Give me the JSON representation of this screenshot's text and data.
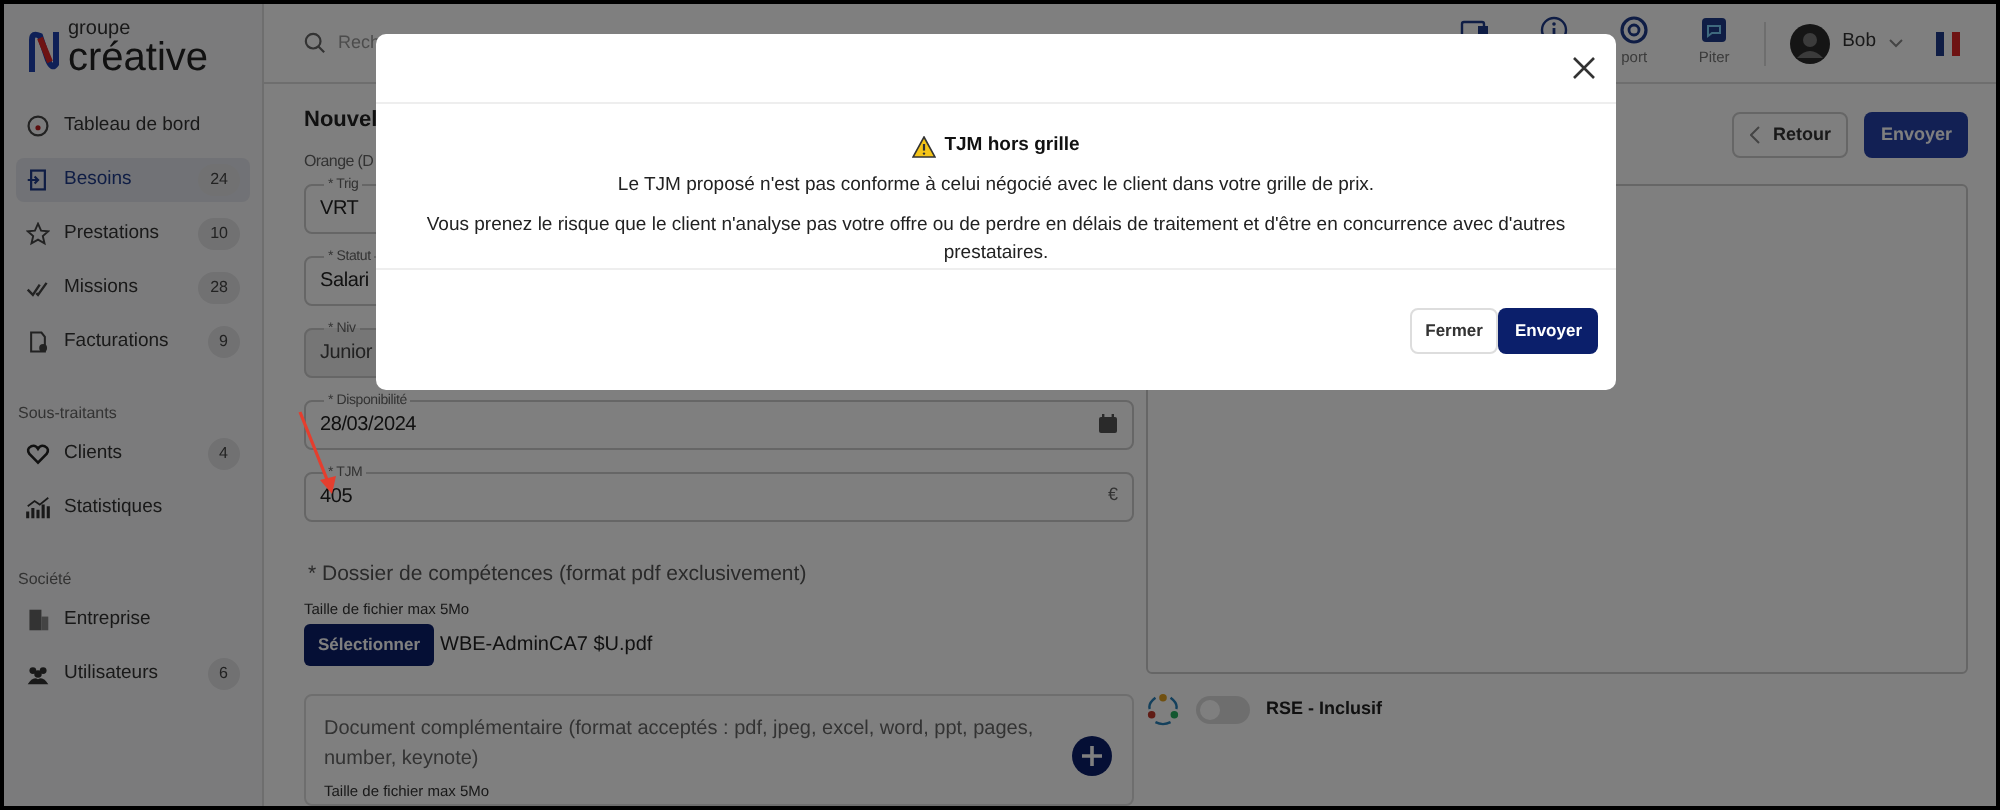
{
  "logo": {
    "line1": "groupe",
    "line2": "créative"
  },
  "sidebar": {
    "groups": [
      {
        "items": [
          {
            "label": "Tableau de bord",
            "selected": false
          },
          {
            "label": "Besoins",
            "count": "24",
            "selected": true
          },
          {
            "label": "Prestations",
            "count": "10",
            "selected": false
          },
          {
            "label": "Missions",
            "count": "28",
            "selected": false
          },
          {
            "label": "Facturations",
            "count": "9",
            "selected": false
          }
        ]
      },
      {
        "title": "Sous-traitants",
        "items": [
          {
            "label": "Clients",
            "count": "4",
            "selected": false
          },
          {
            "label": "Statistiques",
            "selected": false
          }
        ]
      },
      {
        "title": "Société",
        "items": [
          {
            "label": "Entreprise",
            "selected": false
          },
          {
            "label": "Utilisateurs",
            "count": "6",
            "selected": false
          }
        ]
      }
    ]
  },
  "header": {
    "search": {
      "placeholder": "Rech"
    },
    "tools": [
      {
        "kind": "chat"
      },
      {
        "kind": "info"
      },
      {
        "kind": "support",
        "label": "port"
      },
      {
        "kind": "assistant",
        "label": "Piter"
      }
    ],
    "user": {
      "name": "Bob"
    }
  },
  "form": {
    "title": "Nouvel",
    "subtitle": "Orange (D",
    "fields": [
      {
        "kind": "text",
        "label": "* Trig",
        "value": "VRT",
        "disabled": false
      },
      {
        "kind": "text",
        "label": "* Statut",
        "value": "Salari",
        "disabled": false
      },
      {
        "kind": "text",
        "label": "* Niv",
        "value": "Junior",
        "disabled": true
      },
      {
        "kind": "date",
        "label": "* Disponibilité",
        "value": "28/03/2024",
        "disabled": false
      },
      {
        "kind": "money",
        "label": "* TJM",
        "value": "405",
        "suffix": "€",
        "disabled": false
      }
    ],
    "upload": {
      "label": "* Dossier de compétences (format pdf exclusivement)",
      "hint": "Taille de fichier max 5Mo",
      "button": "Sélectionner",
      "file": "WBE-AdminCA7 $U.pdf"
    },
    "extra": {
      "label": "Document complémentaire (format acceptés : pdf, jpeg, excel, word, ppt, pages, number, keynote)",
      "hint": "Taille de fichier max 5Mo"
    },
    "rse": {
      "label": "RSE - Inclusif",
      "on": false
    },
    "buttons": {
      "back": "Retour",
      "submit": "Envoyer"
    }
  },
  "modal": {
    "title": "TJM hors grille",
    "messages": [
      "Le TJM proposé n'est pas conforme à celui négocié avec le client dans votre grille de prix.",
      "Vous prenez le risque que le client n'analyse pas votre offre ou de perdre en délais de traitement et d'être en concurrence avec d'autres prestataires."
    ],
    "buttons": {
      "close": "Fermer",
      "confirm": "Envoyer"
    }
  }
}
